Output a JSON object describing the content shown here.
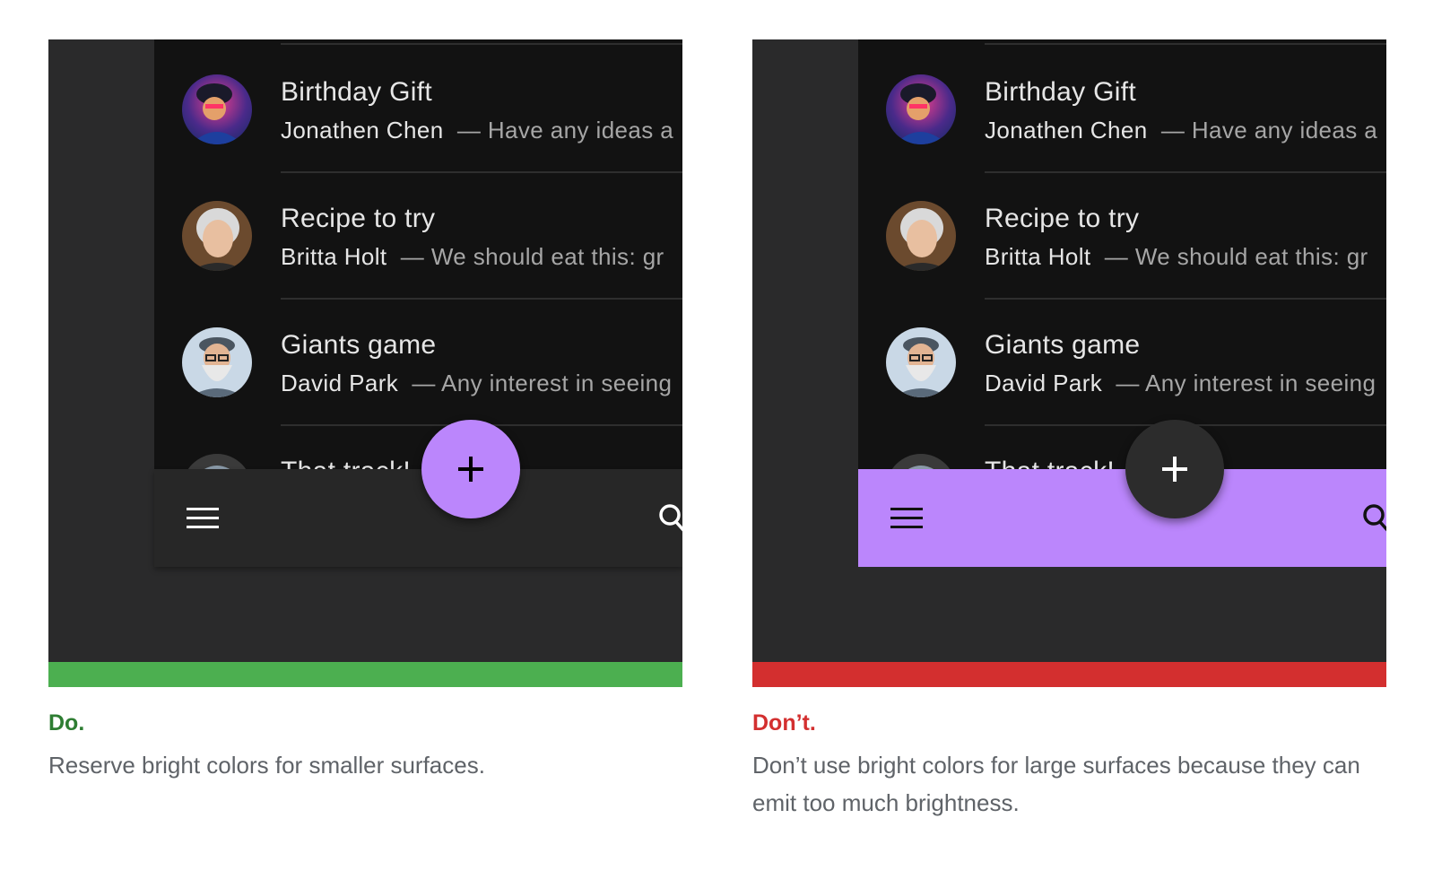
{
  "emails": [
    {
      "title": "Birthday Gift",
      "sender": "Jonathen Chen",
      "snippet": "— Have any ideas a"
    },
    {
      "title": "Recipe to try",
      "sender": "Britta Holt",
      "snippet": "— We should eat this: gr"
    },
    {
      "title": "Giants game",
      "sender": "David Park",
      "snippet": "— Any interest in seeing"
    },
    {
      "title": "That track!",
      "sender": "",
      "snippet": ""
    }
  ],
  "do_panel": {
    "heading": "Do.",
    "caption": "Reserve bright colors for smaller surfaces.",
    "bar_color": "#4caf50",
    "accent": "#bb86fc"
  },
  "dont_panel": {
    "heading": "Don’t.",
    "caption": "Don’t use bright colors for large surfaces because they can emit too much brightness.",
    "bar_color": "#d32f2f",
    "accent": "#bb86fc"
  },
  "icons": {
    "menu": "menu-icon",
    "search": "search-icon",
    "fab": "add-icon"
  }
}
